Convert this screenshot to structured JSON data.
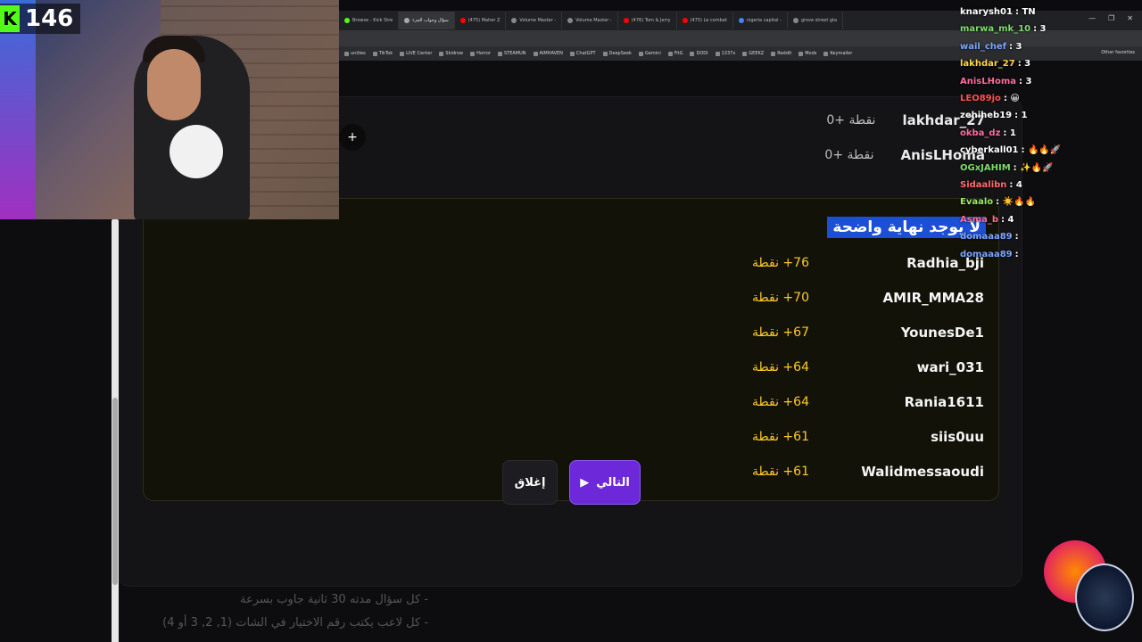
{
  "browser": {
    "tabs": [
      {
        "label": "Browse - Kick Stre",
        "color": "#53fc18"
      },
      {
        "label": "سؤال وجواب الجزء",
        "color": "#aaaaaa",
        "active": true
      },
      {
        "label": "(475) Maher Z",
        "color": "#ff0000"
      },
      {
        "label": "Volume Master -",
        "color": "#888888"
      },
      {
        "label": "Volume Master -",
        "color": "#888888"
      },
      {
        "label": "(476) Tom & Jerry",
        "color": "#ff0000"
      },
      {
        "label": "(475) Le combat",
        "color": "#ff0000"
      },
      {
        "label": "nigeria capital -",
        "color": "#4285f4"
      },
      {
        "label": "grove street gta",
        "color": "#888888"
      }
    ],
    "bookmarks": [
      "unities",
      "TikTok",
      "LIVE Center",
      "Skidrow",
      "Horror",
      "STEAMUN",
      "AIMHAVEN",
      "ChatGPT",
      "DeepSeek",
      "Gemini",
      "FitG",
      "DODI",
      "1337x",
      "GEEKZ",
      "Reddit",
      "Mods",
      "Keymailer"
    ],
    "bookmarks_right": "Other favorites"
  },
  "stream": {
    "viewer_count": "146",
    "kick_icon": "K"
  },
  "background_list": [
    {
      "name": "lakhdar_27",
      "points": "0+ نقطة"
    },
    {
      "name": "AnisLHoma",
      "points": "0+ نقطة"
    }
  ],
  "modal": {
    "title": "لا يوجد نهاية واضحة",
    "rows": [
      {
        "name": "Radhia_bji",
        "points": "76+ نقطة"
      },
      {
        "name": "AMIR_MMA28",
        "points": "70+ نقطة"
      },
      {
        "name": "YounesDe1",
        "points": "67+ نقطة"
      },
      {
        "name": "wari_031",
        "points": "64+ نقطة"
      },
      {
        "name": "Rania1611",
        "points": "64+ نقطة"
      },
      {
        "name": "siis0uu",
        "points": "61+ نقطة"
      },
      {
        "name": "Walidmessaoudi",
        "points": "61+ نقطة"
      }
    ]
  },
  "buttons": {
    "close_label": "إغلاق",
    "next_label": "التالي"
  },
  "rules": [
    "- كل سؤال مدته 30 ثانية جاوب بسرعة",
    "- كل لاعب يكتب رقم الاختيار في الشات (1, 2, 3 أو 4)"
  ],
  "chat": [
    {
      "user": "knarysh01",
      "text": ": TN",
      "color": "#ffffff"
    },
    {
      "user": "marwa_mk_10",
      "text": ": 3",
      "color": "#7ddc6a"
    },
    {
      "user": "wail_chef",
      "text": ": 3",
      "color": "#7aa7ff"
    },
    {
      "user": "lakhdar_27",
      "text": ": 3",
      "color": "#ffd54a"
    },
    {
      "user": "AnisLHoma",
      "text": ": 3",
      "color": "#ff6b9a"
    },
    {
      "user": "LEO89jo",
      "text": ": 😀",
      "color": "#ff5050"
    },
    {
      "user": "zehiheb19",
      "text": ": 1",
      "color": "#ffffff"
    },
    {
      "user": "okba_dz",
      "text": ": 1",
      "color": "#ff6b9a"
    },
    {
      "user": "cyberkall01",
      "text": ": 🔥🔥🚀",
      "color": "#ffffff"
    },
    {
      "user": "OGxJAHIM",
      "text": ": ✨🔥🚀",
      "color": "#7ddc6a"
    },
    {
      "user": "Sidaalibn",
      "text": ": 4",
      "color": "#ff6b6b"
    },
    {
      "user": "Evaalo",
      "text": ": ☀️🔥🔥",
      "color": "#9ee86a"
    },
    {
      "user": "Asma_b",
      "text": ": 4",
      "color": "#ff6b9a"
    },
    {
      "user": "domaaa89",
      "text": ":",
      "color": "#7aa7ff"
    },
    {
      "user": "domaaa89",
      "text": ":",
      "color": "#7aa7ff"
    }
  ]
}
